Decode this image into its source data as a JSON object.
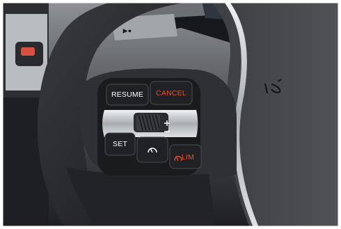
{
  "photo": {
    "subject": "steering-wheel-cruise-control-buttons",
    "colors": {
      "leather": "#2a2b2e",
      "wheel_plastic": "#3b3d41",
      "button_face": "#1f2023",
      "chrome": "#c9ccd0",
      "accent_orange": "#e8502f",
      "dashboard_dark": "#17181b"
    }
  },
  "buttons": {
    "resume": "RESUME",
    "cancel": "CANCEL",
    "set": "SET",
    "limiter": "LIM"
  },
  "dash_badge": "▶●"
}
